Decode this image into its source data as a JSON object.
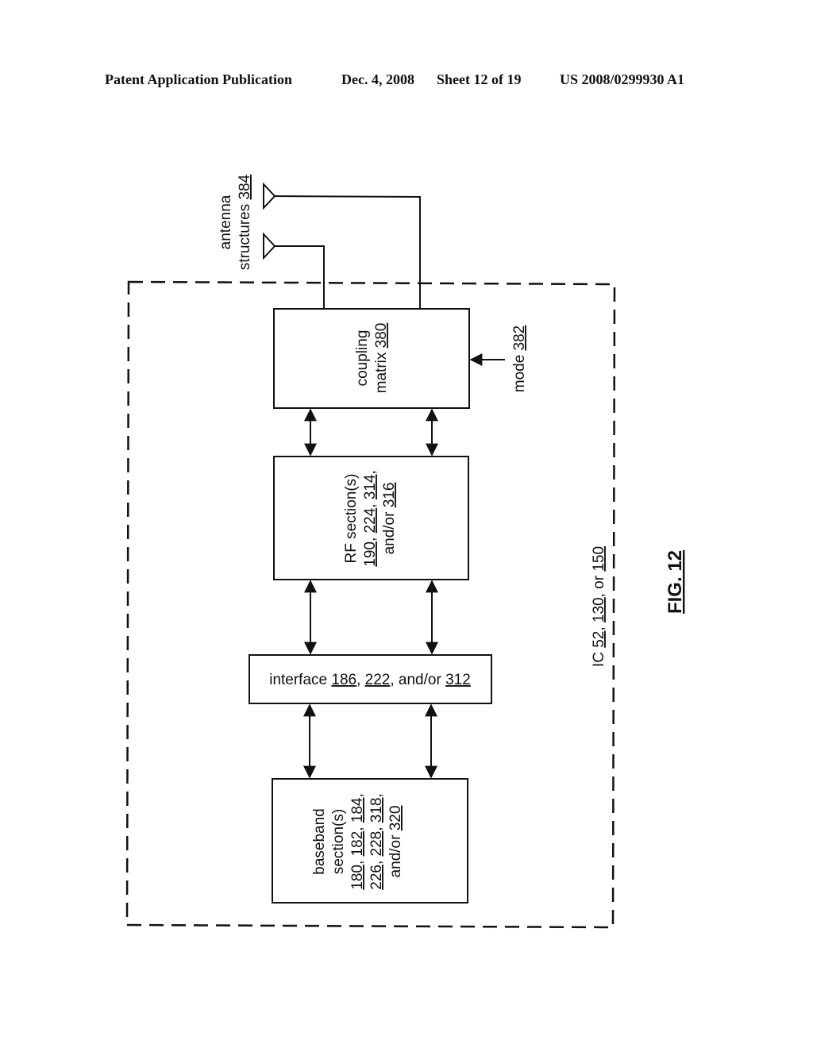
{
  "header": {
    "publication": "Patent Application Publication",
    "date": "Dec. 4, 2008",
    "sheet": "Sheet 12 of 19",
    "number": "US 2008/0299930 A1"
  },
  "diagram": {
    "figure_label": "FIG. 12",
    "ic": {
      "prefix": "IC ",
      "ref1": "52",
      "sep1": ", ",
      "ref2": "130",
      "sep2": ", or ",
      "ref3": "150"
    },
    "antenna": {
      "line1": "antenna",
      "line2_text": "structures ",
      "line2_ref": "384"
    },
    "coupling_matrix": {
      "line1": "coupling",
      "line2_text": "matrix  ",
      "line2_ref": "380"
    },
    "mode": {
      "text": "mode ",
      "ref": "382"
    },
    "rf_section": {
      "line1": "RF section(s)",
      "line2": {
        "r1": "190",
        "s1": ", ",
        "r2": "224",
        "s2": ", ",
        "r3": "314",
        "s3": ","
      },
      "line3": {
        "text": "and/or ",
        "ref": "316"
      }
    },
    "interface": {
      "prefix": "interface ",
      "r1": "186",
      "s1": ", ",
      "r2": "222",
      "s2": ", and/or ",
      "r3": "312"
    },
    "baseband": {
      "line1": "baseband",
      "line2": "section(s)",
      "line3": {
        "r1": "180",
        "s1": ", ",
        "r2": "182",
        "s2": ", ",
        "r3": "184",
        "s3": ","
      },
      "line4": {
        "r1": "226",
        "s1": ", ",
        "r2": "228",
        "s2": ", ",
        "r3": "318",
        "s3": ","
      },
      "line5": {
        "text": "and/or ",
        "ref": "320"
      }
    }
  }
}
